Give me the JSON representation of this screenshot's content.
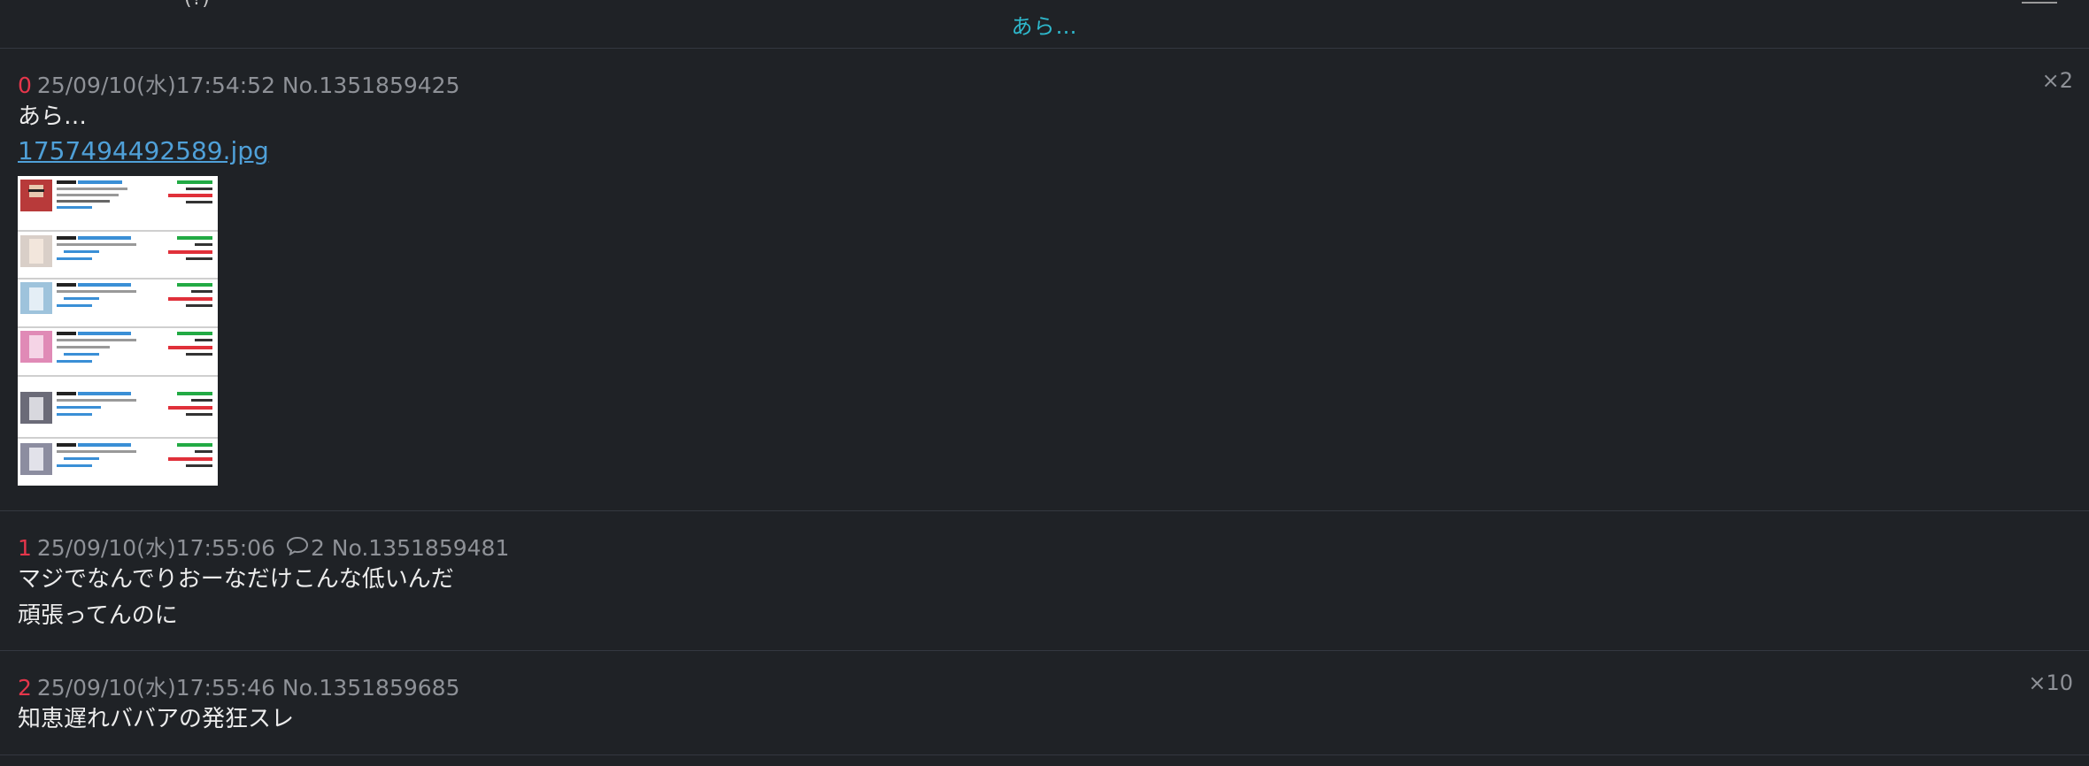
{
  "header": {
    "title": "あら…",
    "partial_left_text": "(?)"
  },
  "posts": [
    {
      "num": "0",
      "meta": "25/09/10(水)17:54:52 No.1351859425",
      "body_lines": [
        "あら…"
      ],
      "file_name": "1757494492589.jpg",
      "count": "×2"
    },
    {
      "num": "1",
      "meta_date": "25/09/10(水)17:55:06",
      "reply_count": "2",
      "meta_no": "No.1351859481",
      "body_lines": [
        "マジでなんでりおーなだけこんな低いんだ",
        "頑張ってんのに"
      ]
    },
    {
      "num": "2",
      "meta": "25/09/10(水)17:55:46 No.1351859685",
      "body_lines": [
        "知恵遅れババアの発狂スレ"
      ],
      "count": "×10"
    }
  ],
  "colors": {
    "background": "#1f2226",
    "accent": "#2eb8cc",
    "post_number": "#e5364b",
    "link": "#4fa0d8",
    "meta": "#8e9197"
  }
}
